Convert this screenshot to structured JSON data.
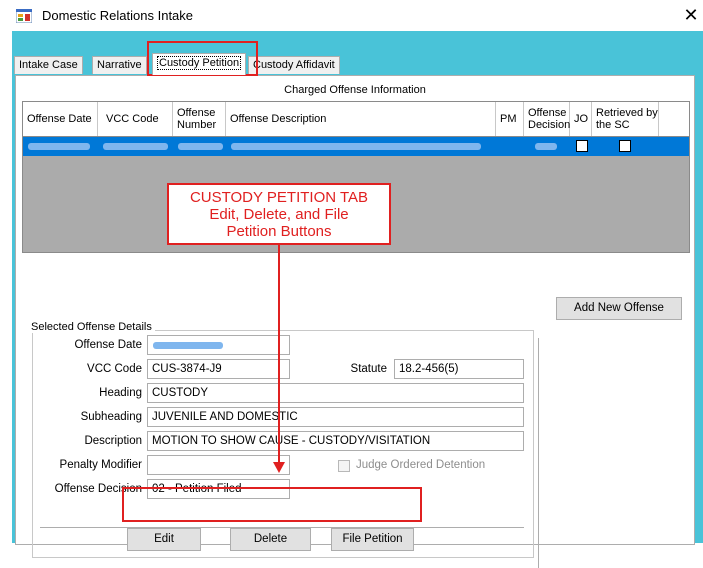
{
  "window": {
    "title": "Domestic Relations Intake",
    "close_glyph": "✕"
  },
  "tabs": [
    {
      "label": "Intake Case"
    },
    {
      "label": "Narrative"
    },
    {
      "label": "Custody Petition"
    },
    {
      "label": "Custody Affidavit"
    }
  ],
  "offense_grid": {
    "caption": "Charged Offense Information",
    "columns": [
      "Offense Date",
      "VCC Code",
      "Offense Number",
      "Offense Description",
      "PM",
      "Offense Decision",
      "JO",
      "Retrieved by the SC"
    ],
    "row_selected": true
  },
  "callout": {
    "line1": "CUSTODY PETITION TAB",
    "line2": "Edit, Delete, and File",
    "line3": "Petition Buttons",
    "color": "#e02020"
  },
  "details": {
    "group_label": "Selected Offense Details",
    "offense_date_label": "Offense Date",
    "vcc_code_label": "VCC Code",
    "vcc_code_value": "CUS-3874-J9",
    "statute_label": "Statute",
    "statute_value": "18.2-456(5)",
    "heading_label": "Heading",
    "heading_value": "CUSTODY",
    "subheading_label": "Subheading",
    "subheading_value": "JUVENILE AND DOMESTIC",
    "description_label": "Description",
    "description_value": "MOTION TO SHOW CAUSE - CUSTODY/VISITATION",
    "penalty_modifier_label": "Penalty Modifier",
    "penalty_modifier_value": "",
    "judge_ordered_label": "Judge Ordered Detention",
    "offense_decision_label": "Offense Decision",
    "offense_decision_value": "02 - Petition Filed"
  },
  "buttons": {
    "add_new_offense": "Add New Offense",
    "edit": "Edit",
    "delete": "Delete",
    "file_petition": "File Petition"
  },
  "colors": {
    "accent": "#49c3d8",
    "selection": "#0078d7",
    "annotation": "#e02020"
  },
  "icons": {
    "app": "app-window-icon",
    "close": "close-icon"
  }
}
